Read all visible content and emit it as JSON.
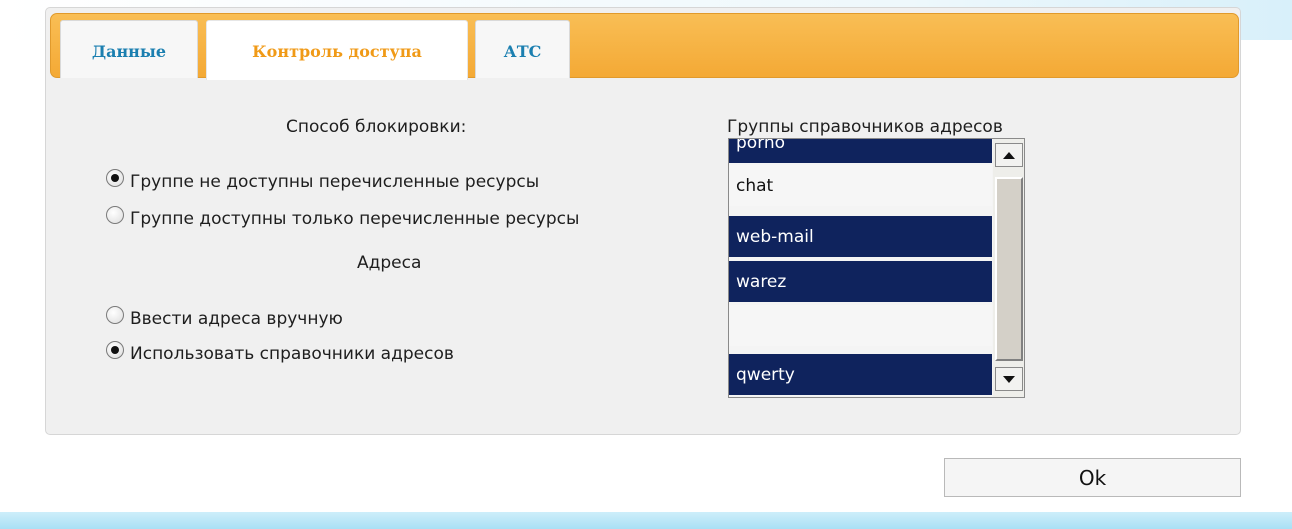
{
  "tabs": [
    {
      "label": "Данные",
      "active": false
    },
    {
      "label": "Контроль доступа",
      "active": true
    },
    {
      "label": "АТС",
      "active": false
    }
  ],
  "blocking": {
    "heading": "Способ блокировки:",
    "options": [
      {
        "label": "Группе не доступны перечисленные ресурсы",
        "checked": true
      },
      {
        "label": "Группе доступны только перечисленные ресурсы",
        "checked": false
      }
    ]
  },
  "addresses": {
    "heading": "Адреса",
    "options": [
      {
        "label": "Ввести адреса вручную",
        "checked": false
      },
      {
        "label": "Использовать справочники адресов",
        "checked": true
      }
    ]
  },
  "directory_groups": {
    "heading": "Группы справочников адресов",
    "items": [
      {
        "label": "porno",
        "selected": true
      },
      {
        "label": "chat",
        "selected": false
      },
      {
        "label": "web-mail",
        "selected": true
      },
      {
        "label": "warez",
        "selected": true
      },
      {
        "label": "",
        "selected": false
      },
      {
        "label": "qwerty",
        "selected": true
      }
    ]
  },
  "buttons": {
    "ok": "Ok"
  },
  "colors": {
    "tab_bar": "#f4a935",
    "active_tab_text": "#f09a17",
    "inactive_tab_text": "#1b7fb0",
    "list_selected_bg": "#0f235d"
  }
}
